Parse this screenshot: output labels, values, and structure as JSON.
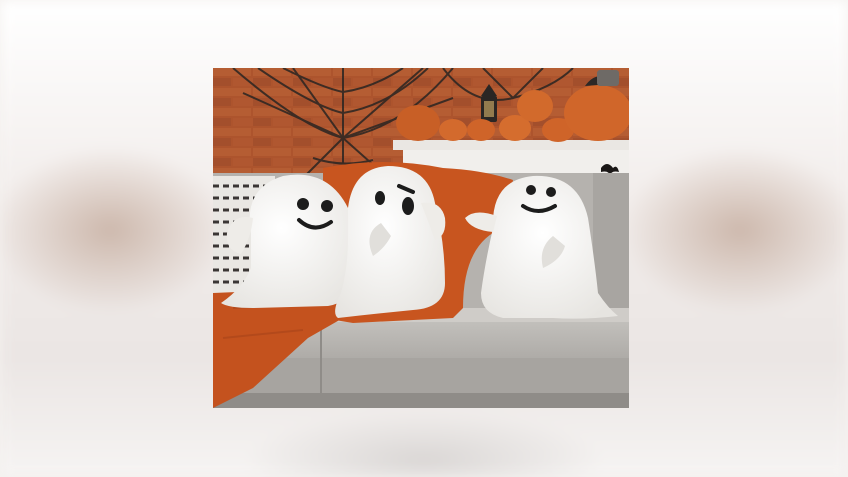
{
  "scene": {
    "subject": "three-ghost-pillows-on-sofa",
    "colors": {
      "brick": "#b4582f",
      "mortar": "#8e4a2c",
      "sofa": "#b9b6b2",
      "throw_blanket": "#c8551f",
      "ghost": "#f4f3f1",
      "face": "#1c1c1c",
      "pumpkin": "#d0662a",
      "backdrop": "#f4f1ef"
    }
  }
}
